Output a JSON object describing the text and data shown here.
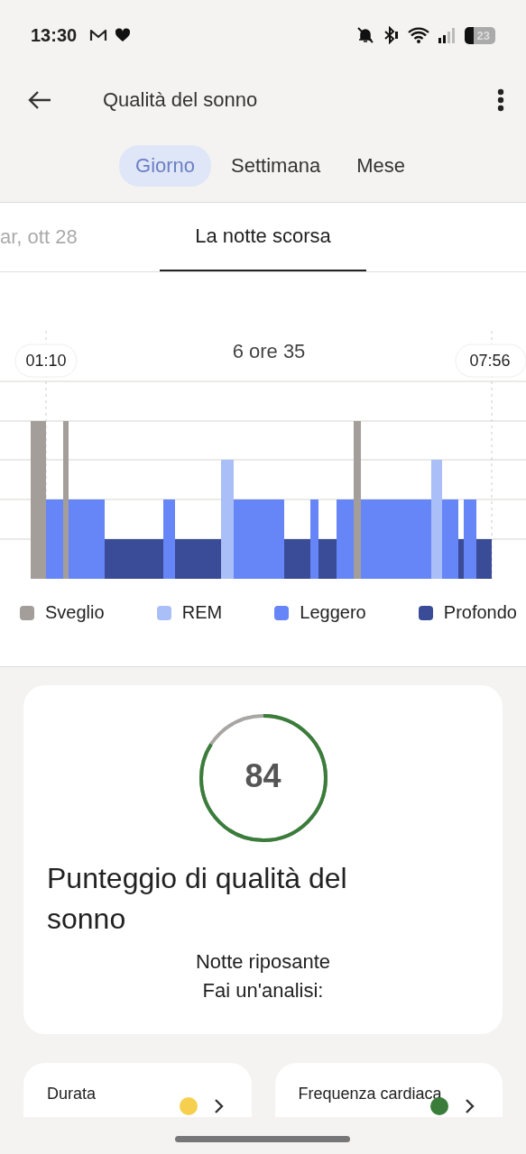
{
  "status_bar": {
    "time": "13:30",
    "battery": "23"
  },
  "app_bar": {
    "title": "Qualità del sonno"
  },
  "tabs": [
    {
      "label": "Giorno",
      "selected": true
    },
    {
      "label": "Settimana",
      "selected": false
    },
    {
      "label": "Mese",
      "selected": false
    }
  ],
  "date_tabs": [
    {
      "label": "ar, ott 28",
      "selected": false
    },
    {
      "label": "La notte scorsa",
      "selected": true
    }
  ],
  "chart": {
    "duration": "6 ore 35",
    "start": "01:10",
    "end": "07:56",
    "legend": [
      {
        "label": "Sveglio",
        "color": "#a39e9a"
      },
      {
        "label": "REM",
        "color": "#aabff7"
      },
      {
        "label": "Leggero",
        "color": "#6685f7"
      },
      {
        "label": "Profondo",
        "color": "#3a4c97"
      }
    ]
  },
  "score": {
    "value": "84",
    "title": "Punteggio di qualità del sonno",
    "summary": "Notte riposante",
    "prompt": "Fai un'analisi:"
  },
  "metrics": [
    {
      "label": "Durata",
      "color": "#f7cf4f"
    },
    {
      "label": "Frequenza cardiaca",
      "color": "#3a7d3a"
    }
  ]
}
